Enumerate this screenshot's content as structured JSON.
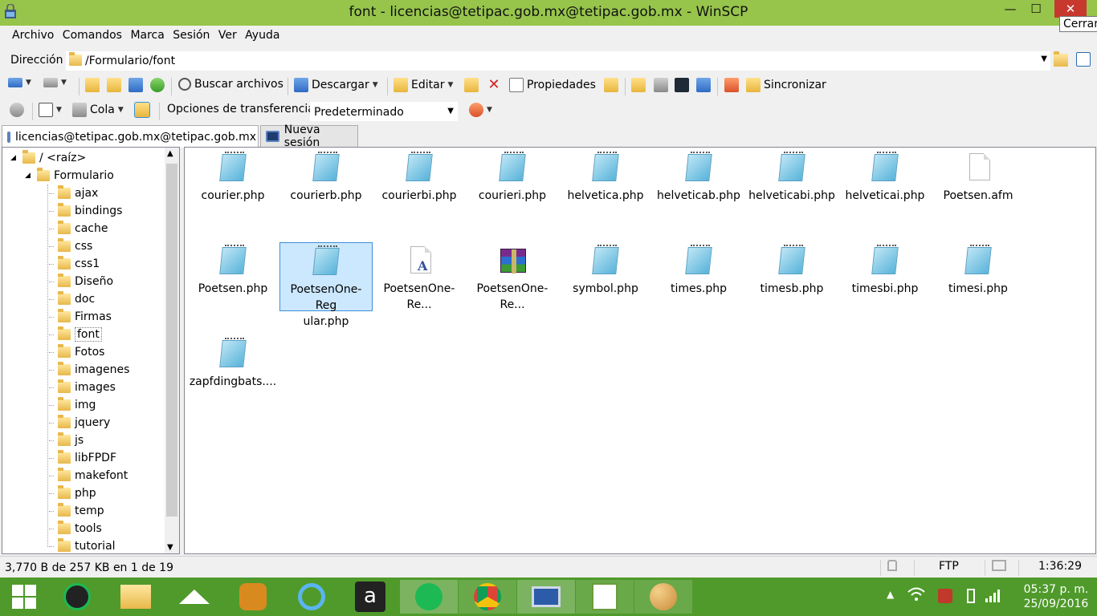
{
  "window": {
    "title": "font - licencias@tetipac.gob.mx@tetipac.gob.mx - WinSCP",
    "min_glyph": "—",
    "max_glyph": "☐",
    "close_glyph": "✕",
    "close_tooltip": "Cerrar"
  },
  "menu": [
    "Archivo",
    "Comandos",
    "Marca",
    "Sesión",
    "Ver",
    "Ayuda"
  ],
  "address": {
    "label": "Dirección",
    "path": "/Formulario/font"
  },
  "toolbar": {
    "find_label": "Buscar archivos",
    "download_label": "Descargar",
    "edit_label": "Editar",
    "properties_label": "Propiedades",
    "sync_label": "Sincronizar",
    "queue_label": "Cola",
    "transfer_label": "Opciones de transferencia",
    "transfer_value": "Predeterminado"
  },
  "tabs": [
    {
      "label": "licencias@tetipac.gob.mx@tetipac.gob.mx"
    },
    {
      "label": "Nueva sesión"
    }
  ],
  "tree": {
    "root_label": "/ <raíz>",
    "parent_label": "Formulario",
    "folders": [
      "ajax",
      "bindings",
      "cache",
      "css",
      "css1",
      "Diseño",
      "doc",
      "Firmas",
      "font",
      "Fotos",
      "imagenes",
      "images",
      "img",
      "jquery",
      "js",
      "libFPDF",
      "makefont",
      "php",
      "temp",
      "tools",
      "tutorial"
    ],
    "selected": "font"
  },
  "files": [
    {
      "name": "courier.php",
      "kind": "php"
    },
    {
      "name": "courierb.php",
      "kind": "php"
    },
    {
      "name": "courierbi.php",
      "kind": "php"
    },
    {
      "name": "courieri.php",
      "kind": "php"
    },
    {
      "name": "helvetica.php",
      "kind": "php"
    },
    {
      "name": "helveticab.php",
      "kind": "php"
    },
    {
      "name": "helveticabi.php",
      "kind": "php"
    },
    {
      "name": "helveticai.php",
      "kind": "php"
    },
    {
      "name": "Poetsen.afm",
      "kind": "afm"
    },
    {
      "name": "Poetsen.php",
      "kind": "php"
    },
    {
      "name": "PoetsenOne-Regular.php",
      "kind": "php",
      "selected": true,
      "display": "PoetsenOne-Reg ular.php"
    },
    {
      "name": "PoetsenOne-Re...",
      "kind": "font"
    },
    {
      "name": "PoetsenOne-Re...",
      "kind": "rar"
    },
    {
      "name": "symbol.php",
      "kind": "php"
    },
    {
      "name": "times.php",
      "kind": "php"
    },
    {
      "name": "timesb.php",
      "kind": "php"
    },
    {
      "name": "timesbi.php",
      "kind": "php"
    },
    {
      "name": "timesi.php",
      "kind": "php"
    },
    {
      "name": "zapfdingbats....",
      "kind": "php"
    }
  ],
  "status": {
    "selection": "3,770 B de 257 KB en 1 de 19",
    "protocol": "FTP",
    "elapsed": "1:36:29"
  },
  "taskbar": {
    "time": "05:37 p. m.",
    "date": "25/09/2016"
  },
  "colors": {
    "titlebar": "#97c54b",
    "taskbar": "#4f9a2b",
    "close": "#c7382f",
    "selection": "#cce8ff"
  }
}
